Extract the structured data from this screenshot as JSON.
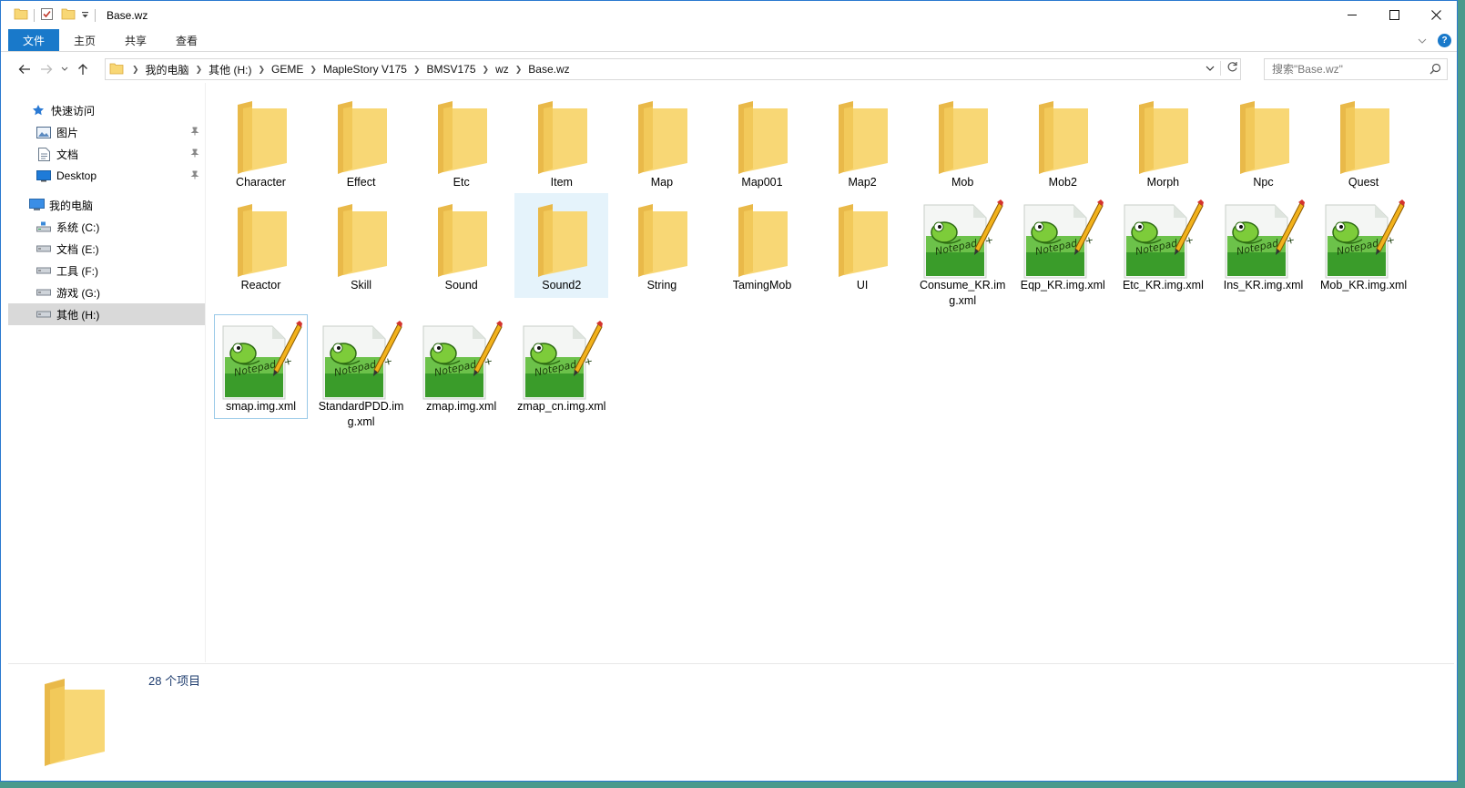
{
  "window": {
    "title": "Base.wz"
  },
  "ribbon": {
    "file": "文件",
    "home": "主页",
    "share": "共享",
    "view": "查看"
  },
  "breadcrumb": [
    "我的电脑",
    "其他 (H:)",
    "GEME",
    "MapleStory V175",
    "BMSV175",
    "wz",
    "Base.wz"
  ],
  "search": {
    "placeholder": "搜索\"Base.wz\""
  },
  "sidebar": {
    "quick_access": "快速访问",
    "pinned": [
      {
        "label": "图片",
        "icon": "pictures-icon"
      },
      {
        "label": "文档",
        "icon": "documents-icon"
      },
      {
        "label": "Desktop",
        "icon": "desktop-icon"
      }
    ],
    "this_pc": "我的电脑",
    "drives": [
      {
        "label": "系统 (C:)",
        "icon": "system-drive-icon"
      },
      {
        "label": "文档 (E:)",
        "icon": "drive-icon"
      },
      {
        "label": "工具 (F:)",
        "icon": "drive-icon"
      },
      {
        "label": "游戏 (G:)",
        "icon": "drive-icon"
      },
      {
        "label": "其他 (H:)",
        "icon": "drive-icon",
        "selected": true
      }
    ]
  },
  "items": [
    {
      "name": "Character",
      "type": "folder"
    },
    {
      "name": "Effect",
      "type": "folder"
    },
    {
      "name": "Etc",
      "type": "folder"
    },
    {
      "name": "Item",
      "type": "folder"
    },
    {
      "name": "Map",
      "type": "folder"
    },
    {
      "name": "Map001",
      "type": "folder"
    },
    {
      "name": "Map2",
      "type": "folder"
    },
    {
      "name": "Mob",
      "type": "folder"
    },
    {
      "name": "Mob2",
      "type": "folder"
    },
    {
      "name": "Morph",
      "type": "folder"
    },
    {
      "name": "Npc",
      "type": "folder"
    },
    {
      "name": "Quest",
      "type": "folder"
    },
    {
      "name": "Reactor",
      "type": "folder"
    },
    {
      "name": "Skill",
      "type": "folder"
    },
    {
      "name": "Sound",
      "type": "folder"
    },
    {
      "name": "Sound2",
      "type": "folder",
      "state": "hover"
    },
    {
      "name": "String",
      "type": "folder"
    },
    {
      "name": "TamingMob",
      "type": "folder"
    },
    {
      "name": "UI",
      "type": "folder"
    },
    {
      "name": "Consume_KR.img.xml",
      "type": "xml"
    },
    {
      "name": "Eqp_KR.img.xml",
      "type": "xml"
    },
    {
      "name": "Etc_KR.img.xml",
      "type": "xml"
    },
    {
      "name": "Ins_KR.img.xml",
      "type": "xml"
    },
    {
      "name": "Mob_KR.img.xml",
      "type": "xml"
    },
    {
      "name": "smap.img.xml",
      "type": "xml",
      "state": "focused"
    },
    {
      "name": "StandardPDD.img.xml",
      "type": "xml"
    },
    {
      "name": "zmap.img.xml",
      "type": "xml"
    },
    {
      "name": "zmap_cn.img.xml",
      "type": "xml"
    }
  ],
  "status": {
    "count": "28 个项目"
  },
  "colors": {
    "accent": "#1979ca",
    "folder": "#f8d775",
    "hover": "#e5f3fb"
  }
}
